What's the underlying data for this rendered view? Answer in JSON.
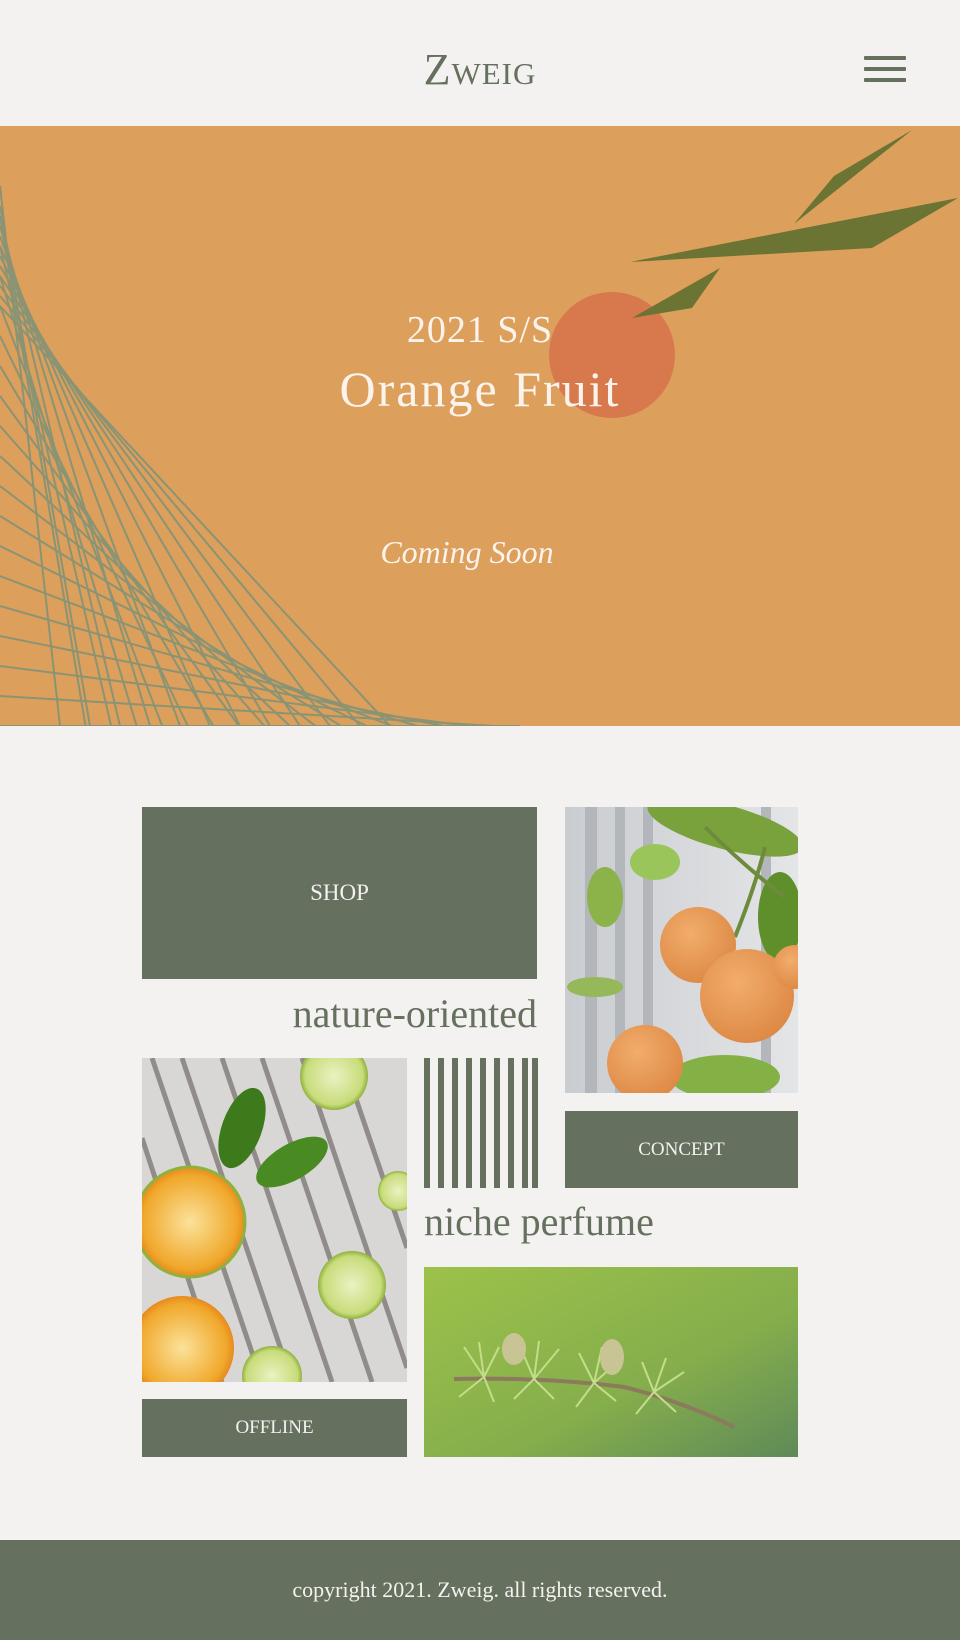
{
  "header": {
    "logo": "Zweig",
    "menu_icon": "hamburger-menu-icon"
  },
  "hero": {
    "year": "2021 S/S",
    "title": "Orange Fruit",
    "subtitle": "Coming Soon",
    "colors": {
      "background": "#dc9f5c",
      "circle": "#d8794d",
      "leaf": "#6b7432",
      "lines": "#8a9474"
    }
  },
  "grid": {
    "shop_label": "SHOP",
    "nature_text": "nature-oriented",
    "concept_label": "CONCEPT",
    "niche_text": "niche perfume",
    "offline_label": "OFFLINE",
    "images": {
      "oranges": "orange-tree-photo",
      "citrus": "sliced-citrus-photo",
      "pine": "pine-branch-photo"
    }
  },
  "footer": {
    "copyright": "copyright 2021. Zweig. all rights reserved."
  },
  "colors": {
    "accent": "#65705f",
    "page_bg": "#f4f2f0"
  }
}
